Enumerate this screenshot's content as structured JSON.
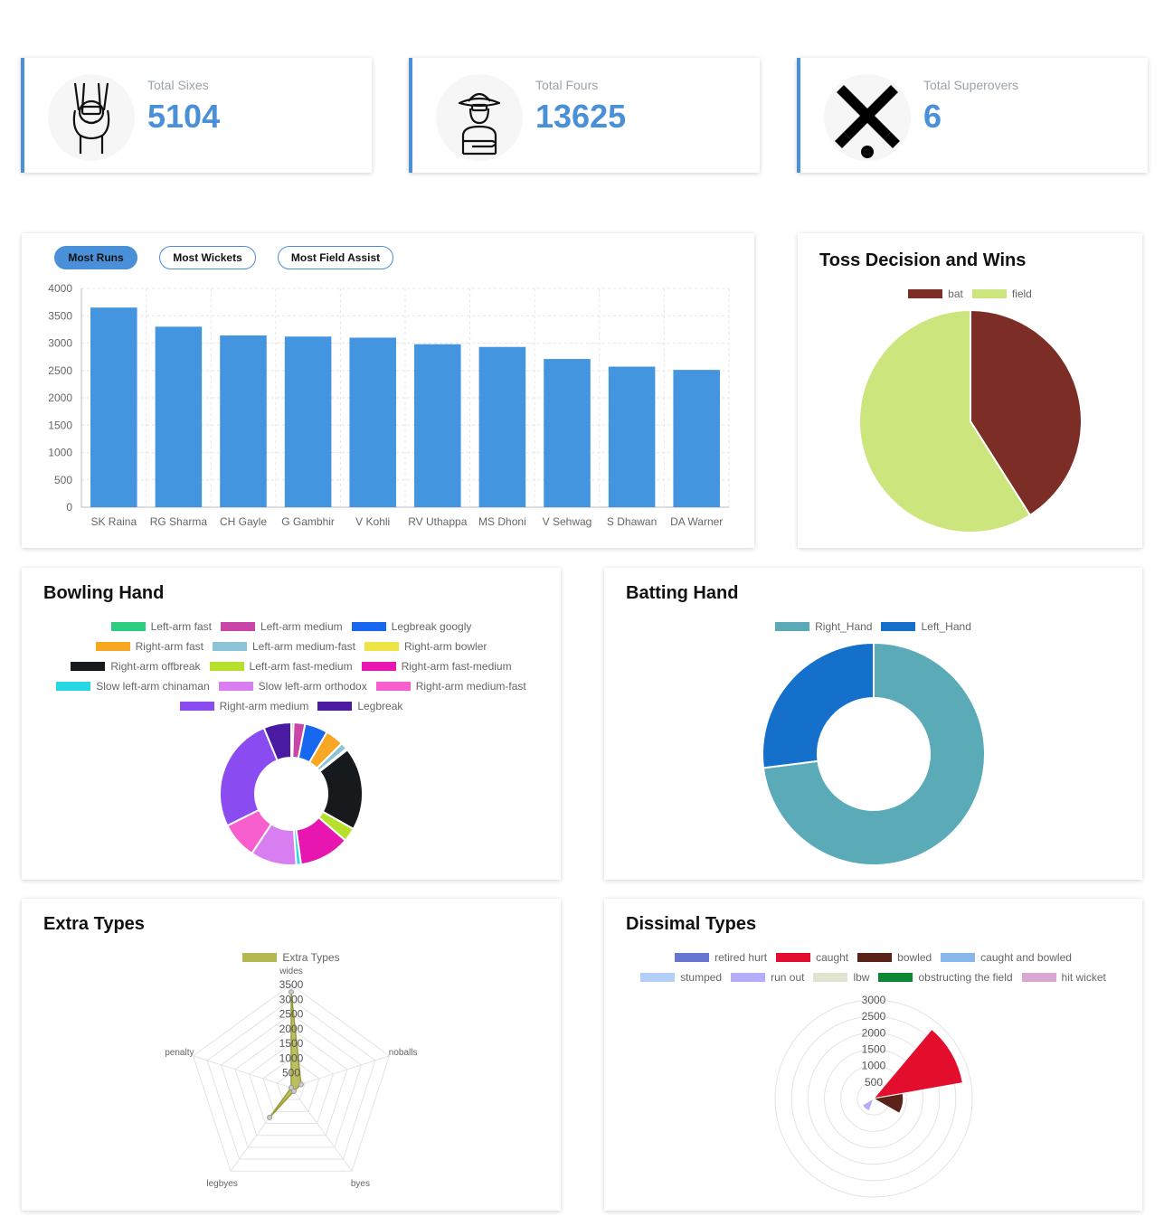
{
  "stats": [
    {
      "label": "Total Sixes",
      "value": "5104",
      "icon": "umpire-six-icon"
    },
    {
      "label": "Total Fours",
      "value": "13625",
      "icon": "umpire-hat-icon"
    },
    {
      "label": "Total Superovers",
      "value": "6",
      "icon": "crossed-bats-icon"
    }
  ],
  "tabs": [
    {
      "label": "Most Runs",
      "active": true
    },
    {
      "label": "Most Wickets",
      "active": false
    },
    {
      "label": "Most Field Assist",
      "active": false
    }
  ],
  "colors": {
    "accent": "#4a90d9"
  },
  "chart_data": [
    {
      "type": "bar",
      "categories": [
        "SK Raina",
        "RG Sharma",
        "CH Gayle",
        "G Gambhir",
        "V Kohli",
        "RV Uthappa",
        "MS Dhoni",
        "V Sehwag",
        "S Dhawan",
        "DA Warner"
      ],
      "values": [
        3650,
        3300,
        3140,
        3120,
        3100,
        2980,
        2930,
        2710,
        2570,
        2510
      ],
      "ylim": [
        0,
        4000
      ],
      "yticks": [
        "4000",
        "3500",
        "3000",
        "2500",
        "2000",
        "1500",
        "1000",
        "500",
        "0"
      ],
      "color": "#4395e0",
      "grid": true
    },
    {
      "type": "pie",
      "title": "Toss Decision and Wins",
      "labels": [
        "bat",
        "field"
      ],
      "values": [
        41,
        59
      ],
      "colors": [
        "#7b2d26",
        "#cce57d"
      ]
    },
    {
      "type": "pie",
      "variant": "doughnut",
      "title": "Bowling Hand",
      "labels": [
        "Left-arm fast",
        "Left-arm medium",
        "Legbreak googly",
        "Right-arm fast",
        "Left-arm medium-fast",
        "Right-arm bowler",
        "Right-arm offbreak",
        "Left-arm fast-medium",
        "Right-arm fast-medium",
        "Slow left-arm chinaman",
        "Slow left-arm orthodox",
        "Right-arm medium-fast",
        "Right-arm medium",
        "Legbreak"
      ],
      "values": [
        0.5,
        2.5,
        5,
        4,
        1.5,
        0.3,
        18,
        3,
        11,
        1,
        10,
        8,
        25,
        6
      ],
      "colors": [
        "#2ecc80",
        "#c946a8",
        "#1768ef",
        "#f8a723",
        "#8cc3d8",
        "#efe445",
        "#161a1d",
        "#b6e02b",
        "#e716b0",
        "#27d7e3",
        "#d97ef0",
        "#f85fce",
        "#8a4cf0",
        "#4a1aa3"
      ]
    },
    {
      "type": "pie",
      "variant": "doughnut",
      "title": "Batting Hand",
      "labels": [
        "Right_Hand",
        "Left_Hand"
      ],
      "values": [
        73,
        27
      ],
      "colors": [
        "#5aaab8",
        "#1570cc"
      ]
    },
    {
      "type": "radar",
      "title": "Extra Types",
      "series_name": "Extra Types",
      "axes": [
        "wides",
        "noballs",
        "byes",
        "legbyes",
        "penalty"
      ],
      "values": [
        3250,
        350,
        150,
        1250,
        0
      ],
      "rmax": 3500,
      "rticks": [
        "500",
        "1000",
        "1500",
        "2000",
        "2500",
        "3000",
        "3500"
      ],
      "color": "#b5b750"
    },
    {
      "type": "polarArea",
      "title": "Dissimal Types",
      "labels": [
        "retired hurt",
        "caught",
        "bowled",
        "caught and bowled",
        "stumped",
        "run out",
        "lbw",
        "obstructing the field",
        "hit wicket"
      ],
      "values": [
        5,
        2750,
        900,
        10,
        100,
        400,
        60,
        2,
        8
      ],
      "rmax": 3000,
      "rticks": [
        "500",
        "1000",
        "1500",
        "2000",
        "2500",
        "3000"
      ],
      "colors": [
        "#6577cf",
        "#e30d2d",
        "#5a2218",
        "#8ab8e8",
        "#b3cff8",
        "#b5adfa",
        "#e0e3cf",
        "#0e8734",
        "#d8a8d2"
      ]
    }
  ]
}
